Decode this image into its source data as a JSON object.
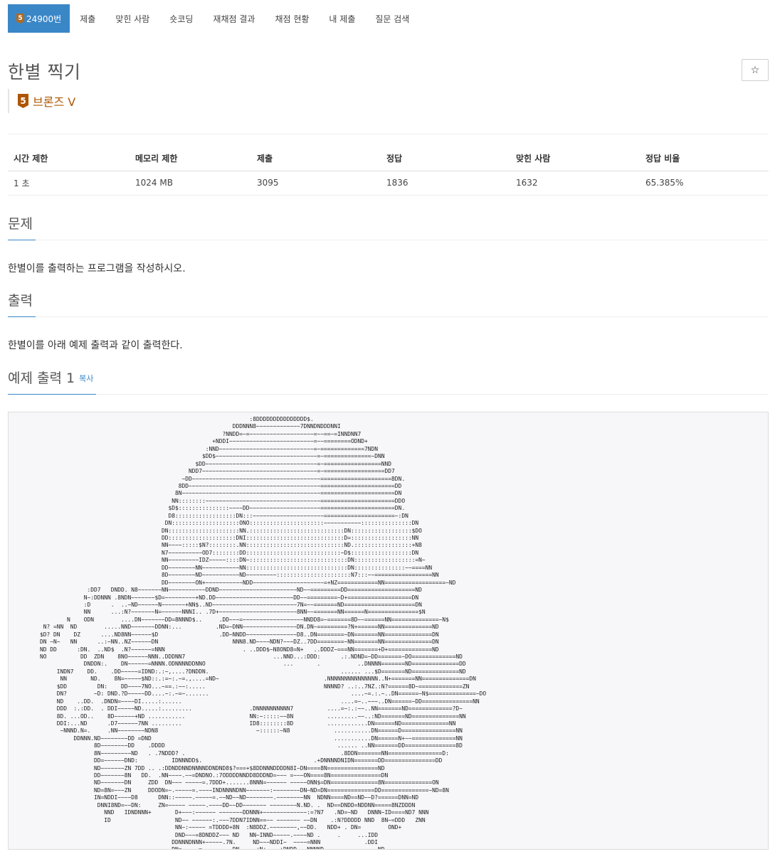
{
  "nav": {
    "problem_tab": {
      "tier_num": "5",
      "label": "24900번"
    },
    "tabs": [
      "제출",
      "맞힌 사람",
      "숏코딩",
      "재채점 결과",
      "채점 현황",
      "내 제출",
      "질문 검색"
    ]
  },
  "problem": {
    "title": "한별 찍기",
    "star_icon": "☆",
    "tier_num": "5",
    "tier_label": "브론즈 V"
  },
  "info": {
    "headers": [
      "시간 제한",
      "메모리 제한",
      "제출",
      "정답",
      "맞힌 사람",
      "정답 비율"
    ],
    "values": [
      "1 초",
      "1024 MB",
      "3095",
      "1836",
      "1632",
      "65.385%"
    ]
  },
  "sections": {
    "problem_title": "문제",
    "problem_text": "한별이를 출력하는 프로그램을 작성하시오.",
    "output_title": "출력",
    "output_text": "한별이를 아래 예제 출력과 같이 출력한다.",
    "sample_title": "예제 출력 1",
    "copy_label": "복사"
  },
  "sample_output": "                                                                  :8DDDDDDDDDDDDDDD$.\n                                                             DDDNNN8~~~~~~~~~~~~~7DNNDNDDDNNI\n                                                          ?NNDD=~=~~~~~~~~~~~~~~~~~~~=~~==~=INNDNN7\n                                                       +NDDI~~~~~~~~~~~~~~~~~~~~~~~~~=~~========ODND+\n                                                     :NND~~~~~~~~~~~~~~~~~~~~~~~~~~~~=~=============7NDN\n                                                    $DD$~~~~~~~~~~~~~~~~~~~~~~~~~~~~~~=~==============~DNN\n                                                  $DD~~~~~~~~~~~~~~~~~~~~~~~~~~~~~~~~~=~=================NND\n                                                NDD7~~~~~~~~~~~~~~~~~~~~~~~~~~~~~~~~~~=~==================DD7\n                                              ~DD~~~~~~~~~~~~~~~~~~~~~~~~~~~~~~~~~~~~~~=====================8DN.\n                                             8DD~~~~~~~~~~~~~~~~~~~~~~~~~~~~~~~~~~~~~~~======================DD\n                                            8N~~~~~~~~~~~~~~~~~~~~~~~~~~~~~~~~~~~~~~~~~======================DN\n                                           NN::::::::~~~~~~~~~~~~~~~~~~~~~~~~~~~~~~~~~~======================DDO\n                                          $D$:::::::::::::::~~~~DD~~~~~~~~~~~~~~~~~~~~~======================DN.\n                                          D8::::::::::::::::::DN:::~~~~~~~~~~~~~~~~~~~~~=====================~:DN\n                                         DN::::::::::::::::::::ONO::::::::::::::::::::::~~~~~~~~~~~:::::::::::::::DN\n                                        DN:::::::::::::::::::::NN.::::::::::::::::::::::::::::DN::::::::::::::::::$DO\n                                        DD::::::::::::::::::::DNI:::::::::::::::::::::::::::::D=::::::::::::::::::NN\n                                        NN~~~~:::::$N?::::::::.NN:::::::::::::::::::::::::::::ND.:::::::::::::::::+N8\n                                        N7~~~~~~~~~~OD7::::::::DD::::::::::::::::::::::::::::~D$::::::::::::::::::DN\n                                        NN~~~~~~~~~IDZ~~~~~::::DN~:::::::::::::::::::::::::::::DN::::::::::::::::::=N~\n                                        DD~~~~~~~~NN~~~~~~~~~~~NN::::::::::::::::::::::::::::::DN:::::::::::::::~~====NN\n                                        8D~~~~~~~~ND~~~~~~~~~~~ND~~~~~~~~~::::::::::::::::::::::N7:::~~=================NN\n                                        DD~~~~~~~~ON+~~~~~~~~~~~NDD~~~~~~~~~~~~~~~~~~~~~=+NZ============NN==================~ND\n                  :DD7   DNDD. N8~~~~~~~NN~~~~~~~~~~~DDND~~~~~~~~~~~~~~~~~~~~~~~ND~~=========DD====================ND\n                 N~:DDNNN .8NDN~~~~~~~$D=~~~~~~~~~+ND.DD~~~~~~~~~~~~~~~~~~~~~~~DD~~=========~D+===================DN\n                 :D      .  ..~ND~~~~~~N~~~~~~~+NN$..ND~~~~~~~~~~~~~~~~~~~~~~~~~7N=~~=======ND=====================DN\n                 NN      ...:N?~~~~~~~N=~~~~~~NNNI.. .7D+~~~~~~~~~~~~~~~~~~~~~~~8NN~~=======NN======N===============$N\n            N    ODN        ....DN~~~~~~~DD=8NNND$..     .DD~~~=~~~~~~~~~~~~~~~~~~NNDD8=~=======8D~~======NN==============~N$\n     N? =NN  ND        .....NND~~~~~~~DDNN:...          .ND=~DNN~~~~~~~~~~~~~~~~DN.DN~=========?N+======NN==============ND\n    $D? DN    DZ      ....ND8NN~~~~~~$D                  .DD~NNDD~~~~~~~~~~~~~~~D8..DN========~DN=======NN==============DN\n    DN ~N~   NN      ..:~NN..NZ~~~~~~DN                      NNN8.ND~~~~NDN?~~~DZ..7DD========~NN=======NN==============DN\n    ND DD      :DN.  ..ND$  .N?~~~~~~=NNN                       . ..DDD$~N8OND8=N+   ..DDDZ~===NN=======+D+=============ND\n    NO          DD  ZDN    8NO~~~~~~NNN..DDDNN7                          ...NND...:DDD:      .:.NDND=~DD=======~DO=============ND\n                 DNDDN:.    DN~~~~~~=NNNN.ODNNNNDDNNO                       ...       .           ..DNNNN=======ND==============DD\n         INDN7    DD.    .DD~~~~~=IDND:.:~,....?DNDDN.                                       ...... ...$D=======ND==============ND\n          NN       ND.    8N=~~~~~$ND::.:=~:.~=.,....=ND~                               .NNNNNNNNNNNNNNN..N+=======NN==============DN\n         $DD         DN:    DD~~~~7NO...~==.:~~:.....                                   NNNND? ..:..7NZ.:N?======8D~=============ZN\n         DN?        ~D: DND.?D~~~~~DD....~:.~=~.......                                          ....~=.:.~..DN======~N$==============~DO\n         ND    ..DD.  .DNDN=~~~~DI.....:......                                               ....=~..~~~..DN======~DD===============NN\n         DDD  :.:DD.  . DDI~~~~~ND.....:.........                 .DNNNNNNNNNN7          ....=~:.:~~..NN=======ND=============?D~\n         8D. ...OD..    8D~~~~~~+ND ...........                   NN:~:::::~~8N          .........~~..:ND=======ND==============NN\n         DDI:...ND      .D7~~~~~~7NN .........                    ID8::::::::8D          ............DN======ND==============NN\n          ~NNND.N=.     .NN~~~~~~~~NDN8                             ~::::::~N8             ...........DN======D================NN\n              DDNNN.ND~~~~~~~~DD =DND                                                      ...........DN======N+~~=============NN\n                    8D~~~~~~~~DD    .DDDD                                                   ...... ..NN=======DD===============8D\n                    8N~~~~~~~~~ND   . .7NDDD? .                                              .8DDN=======NN================D:\n                    DD=~~~~~~DND:          IDNNNDD$.                                 .+DNNNNDNIDN=======DD===============DD\n                    ND~~~~~~~ZN 7DD .. .:DDNDDNNDNNNNDDNDND8$?===+$8DDNNNDDDDN8I~DN====8N===============ND\n                    DD~~~~~~~8N   DD.  .NN~~~~.~~=DNDNO.:7ODDDDNNDD8DDDND=~~~ =~~~ON====8N===============DN\n                    ND~~~~~~~DN     ZDD  DN~~~ ~~~~~=.7DDD+.......8NNN=~~~~~~ ~~~~~ONN$=DN==============8N==============ON\n                    ND=8N=~~~ZN     DDODN=~.~~~~~=.~~~~INDNNNNDNN~~~~~~~:~~~~~~~~DN~ND=DN==============DD==============~ND=8N\n                    IN=NDDI~~~~D8      DNN::~~~~~.~~~~~=.~~ND~~ND~~~~~~~~.~~~~~~~~NN  NDNN====ND==ND~~D?======DNN=ND\n                     DNNI8ND=~~DN:     ZN=~~~~~ ~~~~~.~~~~DD~~DD~~~~~~~ ~~~~~~~~N.ND. .  ND==DNDD=NDDNN=====8NZDDDN\n                       NND   IDNDNNN+       D+~~~:~~~~~~ ~~~~~~~DDNNN+~~~~~~~~~~~~~:=?N7   .ND=~ND   DNNN~ID====ND7 NNN\n                       ID                   ND~~ ~~~~~~:.~~~7DDN7IDNN==~~ ~~~~~~~ ~~DN    .:N?DDDDD NND  8N~=DDD   ZNN\n                                            NN~:~~~~~ =TDDDD+8N  :N8DDZ.~~~~~~~~,~~DD.   NDD+ . DN=        OND+\n                                            DND~~~=8DNDDZ~~~ ND   NN~INND~~~~~.~~~~ND .     .     ...IDD\n                                           DDNNNDNNN+~~~~~.7N.     ND~~~NDDI~  ~~~~=NNN             .DDI\n                                           DN=~~~~.=~~~~~~ ~~DN     +N+~~~~+DNDD~~~NNNND.             ..ND\n                                           DDI=~ ~~~~~~~ ~~~ND..  ..ND~~~~:~~~DNDNNNN+              ..7O8ND+\n                                            .DND=~~~~=:~~=NN.    .  . 8D~~.~~~~~~~=DN$ODNDNDNNNDNNNNND8+~..\n                                              8DNNI=.~~~~~~=NDDNNNNNDDNDNN.~~~~~IDDNDND7:.\n                                                 ?DNNDD?~DD          ~NN~~=NDD$\n                                                       :DDD.            NNNN="
}
